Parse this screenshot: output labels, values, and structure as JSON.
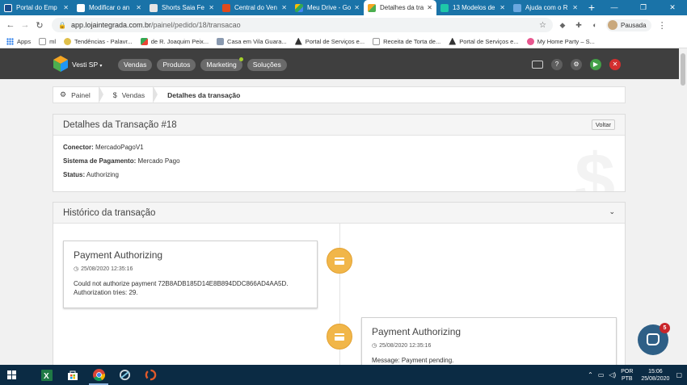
{
  "browser": {
    "tabs": [
      {
        "title": "Portal do Emp",
        "icon": "portal-icon",
        "color": "#1a4c8b"
      },
      {
        "title": "Modificar o an",
        "icon": "document-icon",
        "color": "#ffffff"
      },
      {
        "title": "Shorts Saia Fe",
        "icon": "shop-icon",
        "color": "#e5e5e5"
      },
      {
        "title": "Central do Ven",
        "icon": "bag-icon",
        "color": "#e04a1d"
      },
      {
        "title": "Meu Drive - Go",
        "icon": "drive-icon",
        "color": "#34a853"
      },
      {
        "title": "Detalhes da tra",
        "icon": "cube-icon",
        "color": "#4caf50",
        "active": true
      },
      {
        "title": "13 Modelos de",
        "icon": "sparkle-icon",
        "color": "#1ec8a8"
      },
      {
        "title": "Ajuda com o R",
        "icon": "plane-icon",
        "color": "#6aa8e0"
      }
    ],
    "url_domain": "app.lojaintegrada.com.br",
    "url_path": "/painel/pedido/18/transacao",
    "profile_label": "Pausada",
    "bookmarks": [
      {
        "label": "Apps",
        "icon": "apps-grid-icon"
      },
      {
        "label": "ml",
        "icon": "bookmark-ml-icon"
      },
      {
        "label": "Tendências - Palavr...",
        "icon": "bookmark-trend-icon"
      },
      {
        "label": "de R. Joaquim Peix...",
        "icon": "maps-icon"
      },
      {
        "label": "Casa em Vila Guara...",
        "icon": "image-icon"
      },
      {
        "label": "Portal de Serviços e...",
        "icon": "portal-icon"
      },
      {
        "label": "Receita de Torta de...",
        "icon": "page-icon"
      },
      {
        "label": "Portal de Serviços e...",
        "icon": "portal-icon"
      },
      {
        "label": "My Home Party – S...",
        "icon": "party-icon"
      }
    ]
  },
  "app": {
    "store_name": "Vesti SP",
    "nav": [
      "Vendas",
      "Produtos",
      "Marketing",
      "Soluções"
    ],
    "colors": {
      "topbar": "#3f3f3f",
      "accent_green": "#4caf50",
      "danger": "#d32f2f",
      "node": "#f1b649"
    }
  },
  "breadcrumb": {
    "home": "Painel",
    "section": "Vendas",
    "current": "Detalhes da transação"
  },
  "details": {
    "title": "Detalhes da Transação #18",
    "back_label": "Voltar",
    "conector_label": "Conector:",
    "conector_value": "MercadoPagoV1",
    "sistema_label": "Sistema de Pagamento:",
    "sistema_value": "Mercado Pago",
    "status_label": "Status:",
    "status_value": "Authorizing"
  },
  "history": {
    "title": "Histórico da transação",
    "entries": [
      {
        "title": "Payment Authorizing",
        "date": "25/08/2020 12:35:16",
        "message_line1": "Could not authorize payment 72B8ADB185D14E8B894DDC866AD4AA5D.",
        "message_line2": "Authorization tries: 29."
      },
      {
        "title": "Payment Authorizing",
        "date": "25/08/2020 12:35:16",
        "message_line1": "Message: Payment pending."
      }
    ]
  },
  "chat": {
    "badge": "5"
  },
  "taskbar": {
    "lang_line1": "POR",
    "lang_line2": "PTB",
    "time": "15:06",
    "date": "25/08/2020"
  }
}
